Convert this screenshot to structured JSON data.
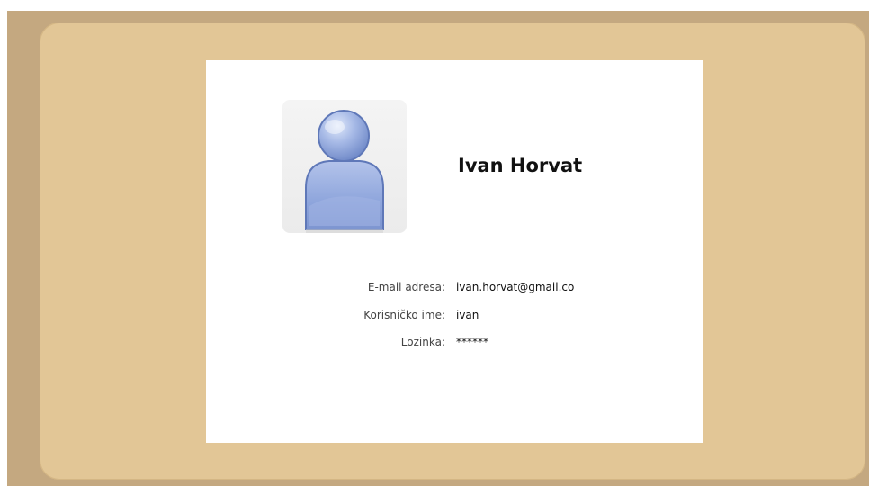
{
  "profile": {
    "name": "Ivan Horvat",
    "avatar_icon": "user-silhouette-icon"
  },
  "fields": {
    "email": {
      "label": "E-mail adresa:",
      "value": "ivan.horvat@gmail.co"
    },
    "username": {
      "label": "Korisničko ime:",
      "value": "ivan"
    },
    "password": {
      "label": "Lozinka:",
      "value": "******"
    }
  },
  "colors": {
    "outer_background": "#c4a880",
    "panel_background": "#e2c696",
    "card_background": "#ffffff",
    "avatar_blue": "#8aa2d6"
  }
}
